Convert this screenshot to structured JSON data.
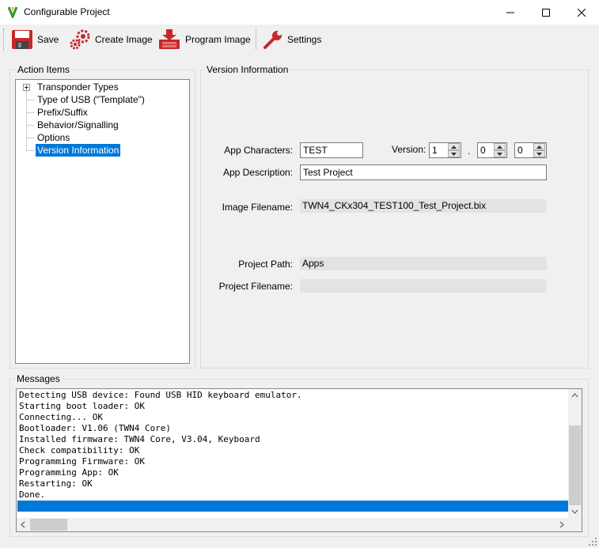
{
  "window": {
    "title": "Configurable Project"
  },
  "toolbar": {
    "save_label": "Save",
    "create_image_label": "Create Image",
    "program_image_label": "Program Image",
    "settings_label": "Settings"
  },
  "action_items": {
    "title": "Action Items",
    "items": [
      {
        "label": "Transponder Types"
      },
      {
        "label": "Type of USB (\"Template\")"
      },
      {
        "label": "Prefix/Suffix"
      },
      {
        "label": "Behavior/Signalling"
      },
      {
        "label": "Options"
      },
      {
        "label": "Version Information"
      }
    ]
  },
  "version_info": {
    "title": "Version Information",
    "app_characters_label": "App Characters:",
    "app_characters_value": "TEST",
    "version_label": "Version:",
    "version_major": "1",
    "version_sep": ".",
    "version_minor": "0",
    "version_patch": "0",
    "app_description_label": "App Description:",
    "app_description_value": "Test Project",
    "image_filename_label": "Image Filename:",
    "image_filename_value": "TWN4_CKx304_TEST100_Test_Project.bix",
    "project_path_label": "Project Path:",
    "project_path_value": "Apps",
    "project_filename_label": "Project Filename:",
    "project_filename_value": ""
  },
  "messages": {
    "title": "Messages",
    "lines": [
      "Detecting USB device: Found USB HID keyboard emulator.",
      "Starting boot loader: OK",
      "Connecting... OK",
      "Bootloader: V1.06 (TWN4 Core)",
      "Installed firmware: TWN4 Core, V3.04, Keyboard",
      "Check compatibility: OK",
      "Programming Firmware: OK",
      "Programming App: OK",
      "Restarting: OK",
      "Done."
    ]
  },
  "colors": {
    "selection": "#0078d7",
    "save_icon": "#c62828",
    "gear_icon": "#c62828"
  }
}
